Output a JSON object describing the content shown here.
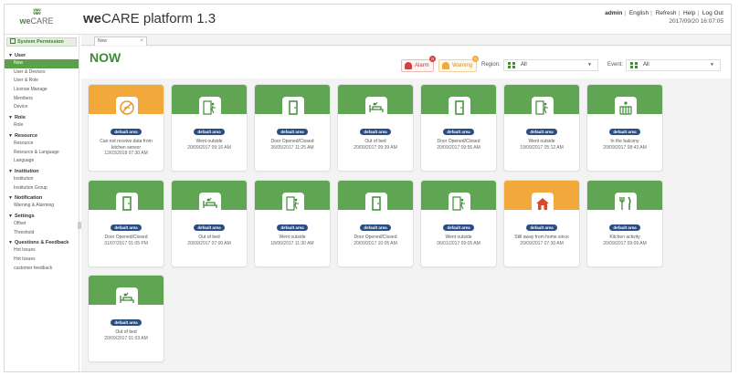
{
  "header": {
    "logo_mark": "ʬʬ",
    "logo_we": "we",
    "logo_care": "CARE",
    "title_we": "we",
    "title_rest": "CARE platform 1.3",
    "nav": [
      "admin",
      "English",
      "Refresh",
      "Help",
      "Log Out"
    ],
    "datetime": "2017/09/20 16:07:05"
  },
  "sidebar": {
    "system_permission": "System Permission",
    "sections": [
      {
        "label": "User",
        "items": [
          "Now",
          "User & Devices",
          "User & Role",
          "License Manage",
          "Members",
          "Device"
        ]
      },
      {
        "label": "Role",
        "items": [
          "Role"
        ]
      },
      {
        "label": "Resource",
        "items": [
          "Resource",
          "Resource & Language",
          "Language"
        ]
      },
      {
        "label": "Institution",
        "items": [
          "Institution",
          "Institution Group"
        ]
      },
      {
        "label": "Notification",
        "items": [
          "Warning & Alarming"
        ]
      },
      {
        "label": "Settings",
        "items": [
          "Offset",
          "Threshold"
        ]
      },
      {
        "label": "Questions & Feedback",
        "items": [
          "Hot Issues",
          "Hot Issues",
          "customer feedback"
        ]
      }
    ],
    "active_item": "Now"
  },
  "tab": {
    "label": "Now",
    "close": "×"
  },
  "page": {
    "title": "NOW",
    "alarm_label": "Alarm",
    "alarm_count": "0",
    "warning_label": "Warning",
    "warning_count": "0",
    "region_label": "Region:",
    "region_value": "All",
    "event_label": "Event:",
    "event_value": "All",
    "dropdown_arrow": "▼"
  },
  "colors": {
    "green": "#5fa554",
    "orange": "#f0a93a",
    "pill": "#2a4d85",
    "title_green": "#3f8c36"
  },
  "cards": [
    {
      "status": "warning",
      "icon": "no-signal-icon",
      "area": "default area",
      "text": "Can not receive data from kitchen sensor",
      "time": "13/03/2018 07:30 AM"
    },
    {
      "status": "normal",
      "icon": "went-outside-icon",
      "area": "default area",
      "text": "Went outside",
      "time": "20/09/2017 09:16 AM"
    },
    {
      "status": "normal",
      "icon": "door-icon",
      "area": "default area",
      "text": "Door Opened/Closed",
      "time": "26/05/2017 11:25 AM"
    },
    {
      "status": "normal",
      "icon": "bed-icon",
      "area": "default area",
      "text": "Out of bed",
      "time": "20/09/2017 09:39 AM"
    },
    {
      "status": "normal",
      "icon": "door-icon",
      "area": "default area",
      "text": "Door Opened/Closed",
      "time": "20/09/2017 09:56 AM"
    },
    {
      "status": "normal",
      "icon": "went-outside-icon",
      "area": "default area",
      "text": "Went outside",
      "time": "19/09/2017 05:12 AM"
    },
    {
      "status": "normal",
      "icon": "balcony-icon",
      "area": "default area",
      "text": "In the balcony",
      "time": "20/09/2017 08:43 AM"
    },
    {
      "status": "normal",
      "icon": "door-icon",
      "area": "default area",
      "text": "Door Opened/Closed",
      "time": "31/07/2017 01:05 PM"
    },
    {
      "status": "normal",
      "icon": "bed-icon",
      "area": "default area",
      "text": "Out of bed",
      "time": "20/09/2017 07:00 AM"
    },
    {
      "status": "normal",
      "icon": "went-outside-icon",
      "area": "default area",
      "text": "Went outside",
      "time": "18/06/2017 11:30 AM"
    },
    {
      "status": "normal",
      "icon": "door-icon",
      "area": "default area",
      "text": "Door Opened/Closed",
      "time": "20/09/2017 10:05 AM"
    },
    {
      "status": "normal",
      "icon": "went-outside-icon",
      "area": "default area",
      "text": "Went outside",
      "time": "06/01/2017 09:05 AM"
    },
    {
      "status": "warning",
      "icon": "home-icon",
      "area": "default area",
      "text": "Still away from home since",
      "time": "20/09/2017 07:30 AM"
    },
    {
      "status": "normal",
      "icon": "kitchen-icon",
      "area": "default area",
      "text": "Kitchen activity",
      "time": "20/09/2017 09:09 AM"
    },
    {
      "status": "normal",
      "icon": "bed-icon",
      "area": "default area",
      "text": "Out of bed",
      "time": "20/09/2017 01:03 AM"
    }
  ]
}
